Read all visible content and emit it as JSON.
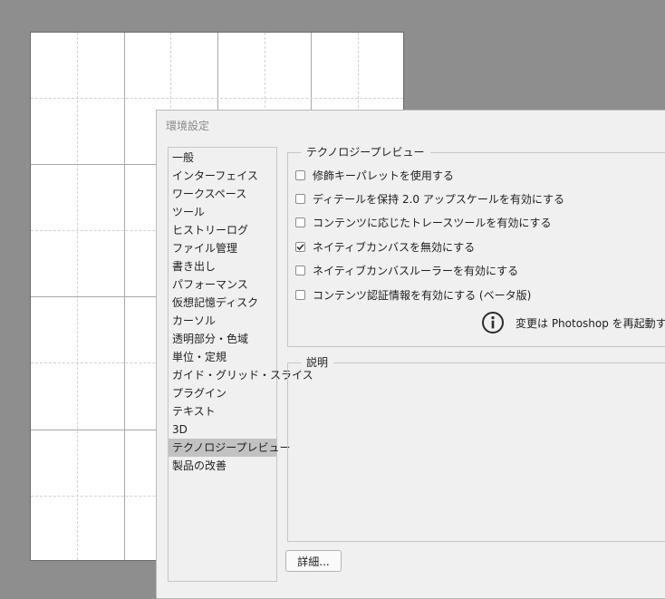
{
  "dialog": {
    "title": "環境設定"
  },
  "sidebar": {
    "items": [
      {
        "label": "一般"
      },
      {
        "label": "インターフェイス"
      },
      {
        "label": "ワークスペース"
      },
      {
        "label": "ツール"
      },
      {
        "label": "ヒストリーログ"
      },
      {
        "label": "ファイル管理"
      },
      {
        "label": "書き出し"
      },
      {
        "label": "パフォーマンス"
      },
      {
        "label": "仮想記憶ディスク"
      },
      {
        "label": "カーソル"
      },
      {
        "label": "透明部分・色域"
      },
      {
        "label": "単位・定規"
      },
      {
        "label": "ガイド・グリッド・スライス"
      },
      {
        "label": "プラグイン"
      },
      {
        "label": "テキスト"
      },
      {
        "label": "3D"
      },
      {
        "label": "テクノロジープレビュー",
        "selected": true
      },
      {
        "label": "製品の改善"
      }
    ]
  },
  "tech_preview": {
    "legend": "テクノロジープレビュー",
    "options": [
      {
        "label": "修飾キーパレットを使用する",
        "checked": false
      },
      {
        "label": "ディテールを保持 2.0 アップスケールを有効にする",
        "checked": false
      },
      {
        "label": "コンテンツに応じたトレースツールを有効にする",
        "checked": false
      },
      {
        "label": "ネイティブカンバスを無効にする",
        "checked": true
      },
      {
        "label": "ネイティブカンバスルーラーを有効にする",
        "checked": false
      },
      {
        "label": "コンテンツ認証情報を有効にする (ベータ版)",
        "checked": false
      }
    ],
    "restart_note": "変更は Photoshop を再起動す",
    "restart_icon": "info-icon"
  },
  "description": {
    "legend": "説明"
  },
  "buttons": {
    "more_label": "詳細..."
  },
  "colors": {
    "workspace_bg": "#8e8e8e",
    "dialog_bg": "#f0f0f0",
    "selected_item_bg": "#c2c2c2"
  }
}
